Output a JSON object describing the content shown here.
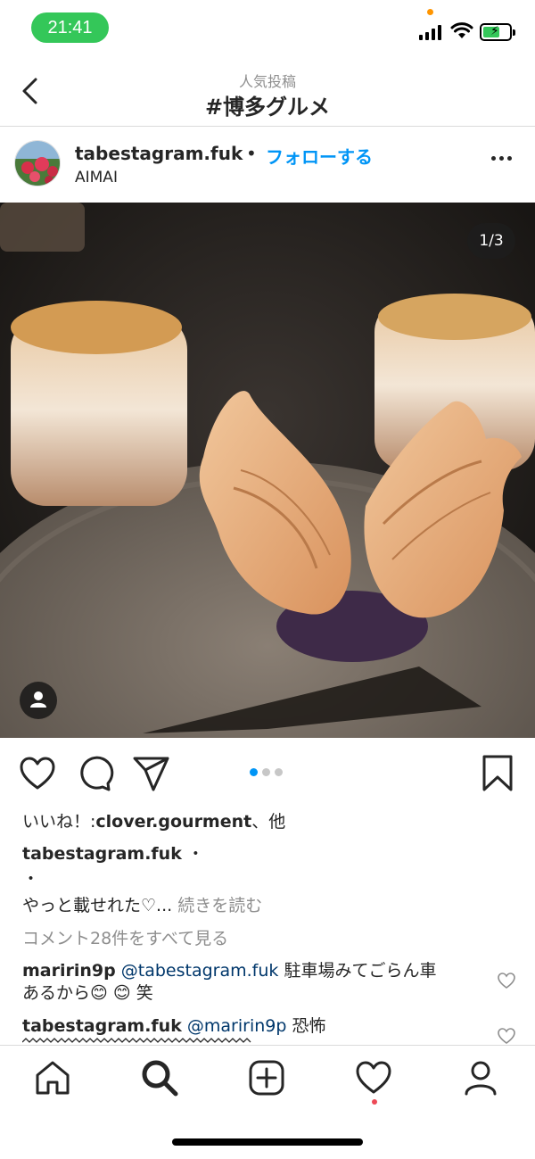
{
  "status_bar": {
    "time": "21:41"
  },
  "nav": {
    "subtitle": "人気投稿",
    "title": "#博多グルメ"
  },
  "post": {
    "username": "tabestagram.fuk",
    "separator": "•",
    "follow_label": "フォローする",
    "location": "AIMAI",
    "carousel_counter": "1/3",
    "carousel": {
      "total": 3,
      "current": 1
    }
  },
  "likes": {
    "prefix": "いいね！:",
    "user": "clover.gourment",
    "suffix": "、他"
  },
  "caption": {
    "username": "tabestagram.fuk",
    "trail": " ・",
    "line2": "・",
    "text": "やっと載せれた♡...",
    "more_label": "続きを読む"
  },
  "view_comments": "コメント28件をすべて見る",
  "comments": [
    {
      "username": "maririn9p",
      "mention": "@tabestagram.fuk",
      "text_line1": " 駐車場みてごらん車",
      "text_line2": "あるから😊 😊 笑"
    },
    {
      "username": "tabestagram.fuk",
      "mention": "@maririn9p",
      "text_line1": " 恐怖"
    }
  ],
  "tab_bar": {
    "items": [
      "home",
      "search",
      "create",
      "activity",
      "profile"
    ],
    "active": "search"
  },
  "colors": {
    "accent": "#0095f6",
    "status_green": "#34c759",
    "notification": "#ed4956",
    "text": "#262626",
    "muted": "#8e8e8e"
  }
}
